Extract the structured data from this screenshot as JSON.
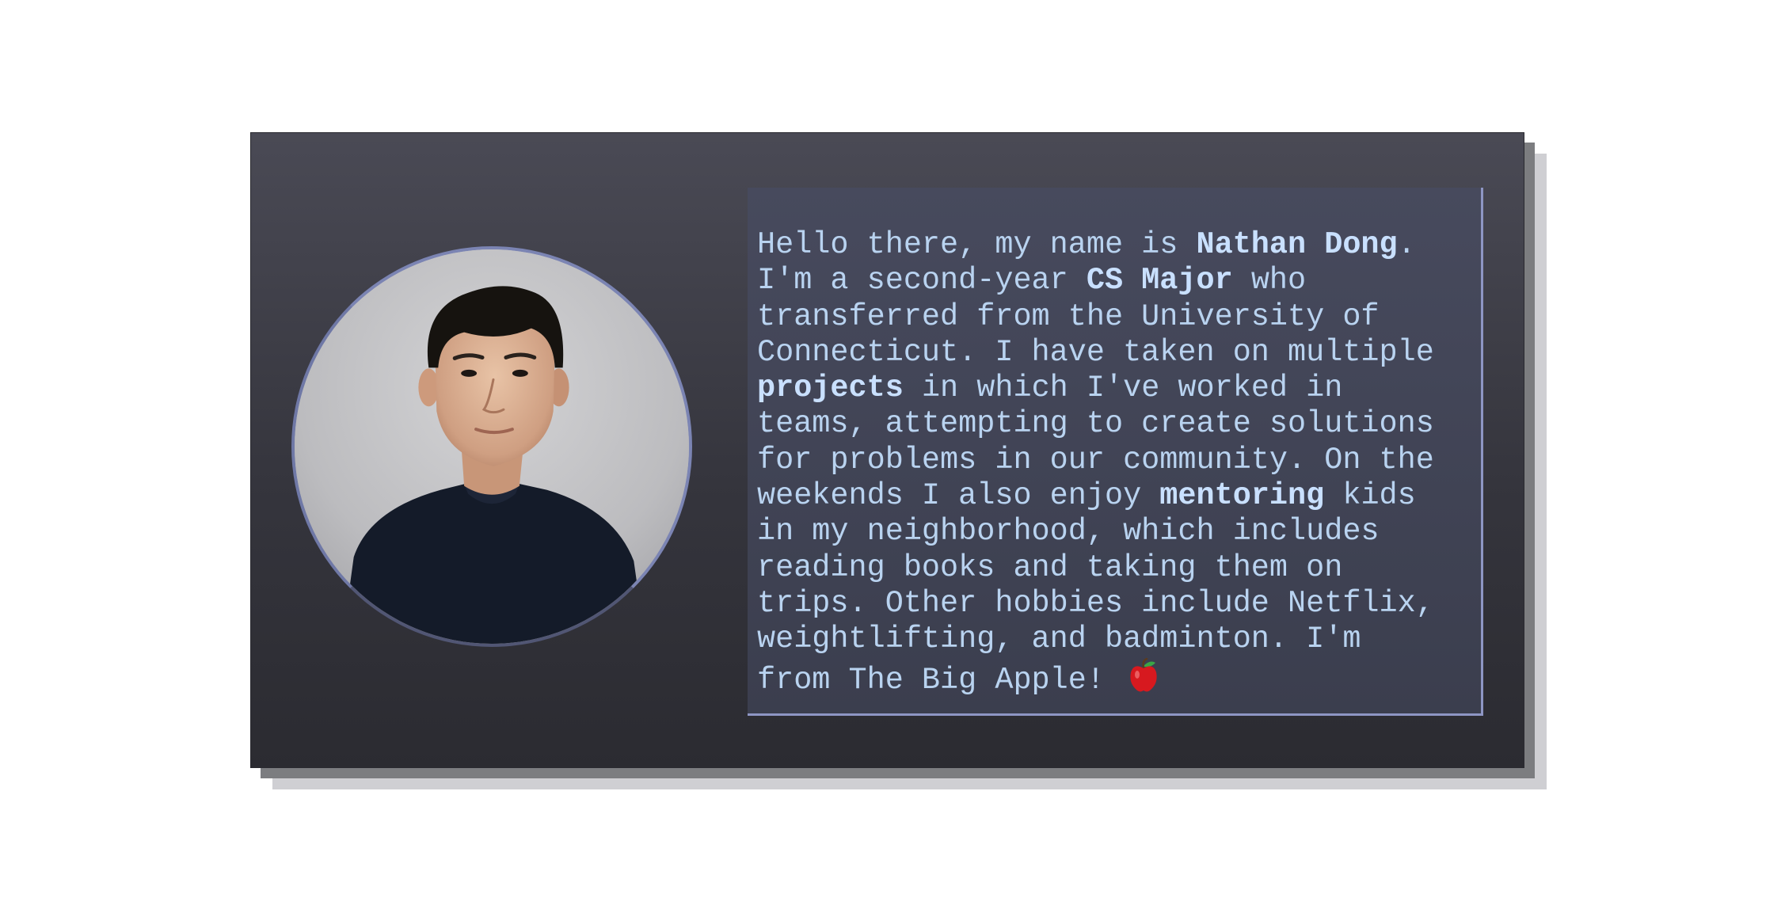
{
  "bio": {
    "line1_pre": "Hello there, my name is ",
    "name": "Nathan Dong",
    "line1_post": ".",
    "line2_pre": "I'm a second-year ",
    "major": "CS Major",
    "line2_post": " who",
    "line3": "transferred from the University of",
    "line4": "Connecticut. I have taken on multiple",
    "projects": "projects",
    "line5_post": " in which I've worked in",
    "line6": "teams, attempting to create solutions",
    "line7": "for problems in our community. On the",
    "line8_pre": "weekends I also enjoy ",
    "mentoring": "mentoring",
    "line8_post": " kids",
    "line9": "in my neighborhood, which includes",
    "line10": "reading books and taking them on",
    "line11": "trips. Other hobbies include Netflix,",
    "line12": "weightlifting, and badminton. I'm",
    "line13": "from The Big Apple! "
  },
  "icons": {
    "apple": "apple-icon",
    "avatar": "profile-photo"
  },
  "colors": {
    "card_top": "#4a4a55",
    "card_bottom": "#2b2b31",
    "text": "#b9d3f0",
    "accent_border": "#8e96c4"
  }
}
